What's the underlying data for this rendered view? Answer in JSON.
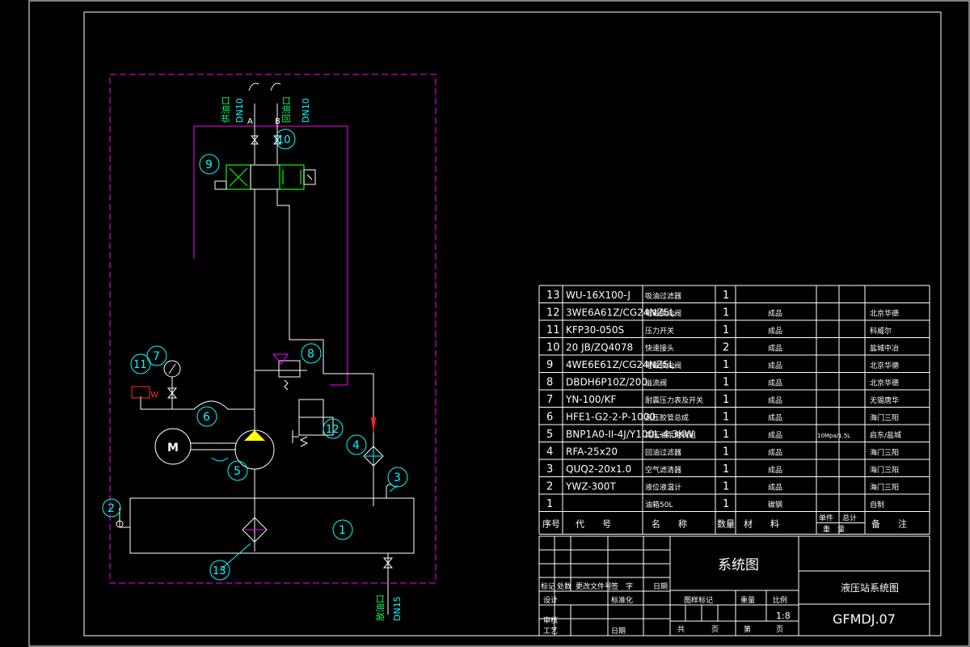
{
  "drawing": {
    "title": "系统图",
    "project_name": "液压站系统图",
    "drawing_number": "GFMDJ.07",
    "scale": "1:8"
  },
  "ports": {
    "port_a_label": "供油口",
    "port_a_size": "DN10",
    "port_a_letter": "A",
    "port_b_label": "回油口",
    "port_b_size": "DN10",
    "port_b_letter": "B",
    "drain_label": "放油口",
    "drain_size": "DN15"
  },
  "balloons": [
    "1",
    "2",
    "3",
    "4",
    "5",
    "6",
    "7",
    "8",
    "9",
    "10",
    "11",
    "12",
    "13"
  ],
  "symbols": {
    "motor": "M",
    "pressure_switch_letter": "W"
  },
  "bom": {
    "rows": [
      {
        "no": "13",
        "code": "WU-16X100-J",
        "name": "吸油过滤器",
        "qty": "1",
        "material": "",
        "weight": "",
        "remark": ""
      },
      {
        "no": "12",
        "code": "3WE6A61Z/CG24NZ5L",
        "name": "电磁换向阀",
        "qty": "1",
        "material": "成品",
        "weight": "",
        "remark": "北京华德"
      },
      {
        "no": "11",
        "code": "KFP30-050S",
        "name": "压力开关",
        "qty": "1",
        "material": "成品",
        "weight": "",
        "remark": "科威尔"
      },
      {
        "no": "10",
        "code": "20 JB/ZQ4078",
        "name": "快速接头",
        "qty": "2",
        "material": "成品",
        "weight": "",
        "remark": "盐城中冶"
      },
      {
        "no": "9",
        "code": "4WE6E61Z/CG24NZ5L",
        "name": "电磁换向阀",
        "qty": "1",
        "material": "成品",
        "weight": "",
        "remark": "北京华德"
      },
      {
        "no": "8",
        "code": "DBDH6P10Z/200",
        "name": "溢流阀",
        "qty": "1",
        "material": "成品",
        "weight": "",
        "remark": "北京华德"
      },
      {
        "no": "7",
        "code": "YN-100/KF",
        "name": "耐震压力表及开关",
        "qty": "1",
        "material": "成品",
        "weight": "",
        "remark": "无锡唐华"
      },
      {
        "no": "6",
        "code": "HFE1-G2-2-P-1000",
        "name": "高压胶管总成",
        "qty": "1",
        "material": "成品",
        "weight": "",
        "remark": "海门三阳"
      },
      {
        "no": "5",
        "code": "BNP1A0-II-4J/Y100L-4 3KW",
        "name": "高压油泵电机组",
        "qty": "1",
        "material": "成品",
        "weight": "10Mpa/1.5L",
        "remark": "启东/盐城"
      },
      {
        "no": "4",
        "code": "RFA-25x20",
        "name": "回油过滤器",
        "qty": "1",
        "material": "成品",
        "weight": "",
        "remark": "海门三阳"
      },
      {
        "no": "3",
        "code": "QUQ2-20x1.0",
        "name": "空气滤清器",
        "qty": "1",
        "material": "成品",
        "weight": "",
        "remark": "海门三阳"
      },
      {
        "no": "2",
        "code": "YWZ-300T",
        "name": "液位液温计",
        "qty": "1",
        "material": "成品",
        "weight": "",
        "remark": "海门三阳"
      },
      {
        "no": "1",
        "code": "",
        "name": "油箱50L",
        "qty": "1",
        "material": "碳钢",
        "weight": "",
        "remark": "自制"
      }
    ],
    "header": {
      "no": "序号",
      "code": "代　　号",
      "name": "名　　称",
      "qty": "数量",
      "material": "材　　料",
      "unit_weight": "单件",
      "total_weight": "总计",
      "weight": "重　量",
      "remark": "备　　注"
    }
  },
  "title_block": {
    "mark": "标记",
    "count": "处数",
    "file": "更改文件号",
    "sign": "签　字",
    "date": "日期",
    "design": "设计",
    "std": "标准化",
    "review": "审核",
    "craft": "工艺",
    "date2": "日期",
    "stage": "图样标记",
    "weight": "重量",
    "scale_label": "比例",
    "total": "共",
    "sheet": "页",
    "page": "第",
    "page2": "页"
  }
}
